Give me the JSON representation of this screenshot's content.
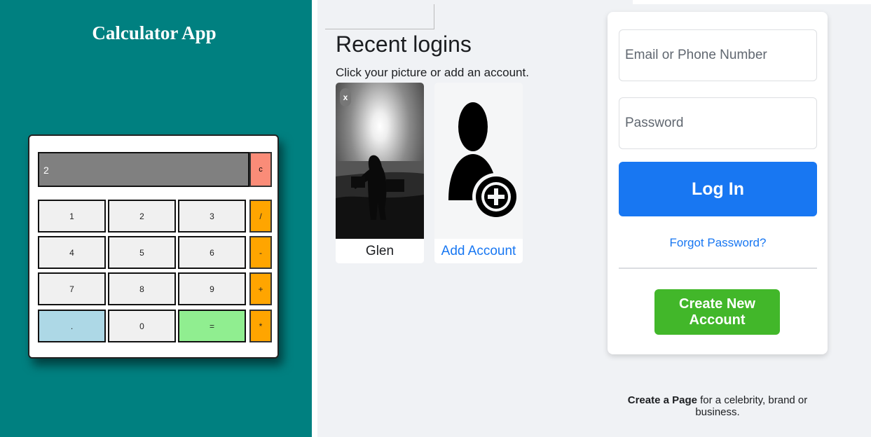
{
  "calculator": {
    "title": "Calculator App",
    "display_value": "2",
    "clear_label": "c",
    "keys": [
      {
        "label": "1"
      },
      {
        "label": "2"
      },
      {
        "label": "3"
      },
      {
        "label": "/"
      },
      {
        "label": "4"
      },
      {
        "label": "5"
      },
      {
        "label": "6"
      },
      {
        "label": "-"
      },
      {
        "label": "7"
      },
      {
        "label": "8"
      },
      {
        "label": "9"
      },
      {
        "label": "+"
      },
      {
        "label": "."
      },
      {
        "label": "0"
      },
      {
        "label": "="
      },
      {
        "label": "*"
      }
    ],
    "colors": {
      "background": "#008080",
      "display": "#808080",
      "clear": "#fa8c78",
      "operator": "#ffa500",
      "dot": "#add8e6",
      "equals": "#90ee90"
    }
  },
  "recent_logins": {
    "title": "Recent logins",
    "subtitle": "Click your picture or add an account.",
    "accounts": [
      {
        "name": "Glen",
        "close_label": "x",
        "photo": "silhouette-sunset-photo"
      }
    ],
    "add_account_label": "Add Account",
    "add_account_icon": "user-plus-icon"
  },
  "login": {
    "email_placeholder": "Email or Phone Number",
    "password_placeholder": "Password",
    "login_label": "Log In",
    "forgot_label": "Forgot Password?",
    "create_label": "Create New Account",
    "colors": {
      "primary": "#1877f2",
      "create": "#42b72a"
    }
  },
  "footer": {
    "create_prefix": "Create a Page",
    "create_suffix": " for a celebrity, brand or business."
  }
}
